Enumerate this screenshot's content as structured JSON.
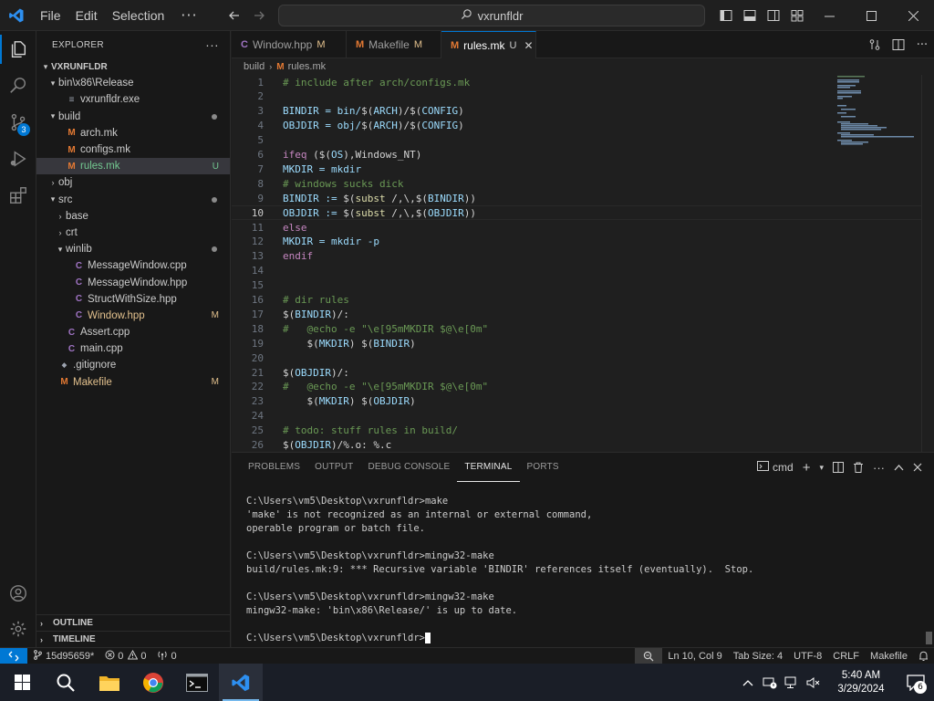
{
  "titlebar": {
    "menus": [
      "File",
      "Edit",
      "Selection"
    ],
    "search_text": "vxrunfldr"
  },
  "activity": {
    "source_control_badge": "3"
  },
  "sidebar": {
    "title": "EXPLORER",
    "root": "VXRUNFLDR",
    "items": [
      {
        "label": "bin\\x86\\Release",
        "depth": 1,
        "type": "folder-open",
        "icon": "folder",
        "deco": ""
      },
      {
        "label": "vxrunfldr.exe",
        "depth": 2,
        "type": "file",
        "icon": "exe",
        "deco": ""
      },
      {
        "label": "build",
        "depth": 1,
        "type": "folder-open",
        "icon": "folder",
        "deco": "dot"
      },
      {
        "label": "arch.mk",
        "depth": 2,
        "type": "file",
        "icon": "M",
        "deco": ""
      },
      {
        "label": "configs.mk",
        "depth": 2,
        "type": "file",
        "icon": "M",
        "deco": ""
      },
      {
        "label": "rules.mk",
        "depth": 2,
        "type": "file",
        "icon": "M",
        "deco": "U",
        "selected": true
      },
      {
        "label": "obj",
        "depth": 1,
        "type": "folder-closed",
        "icon": "folder",
        "deco": ""
      },
      {
        "label": "src",
        "depth": 1,
        "type": "folder-open",
        "icon": "folder",
        "deco": "dot"
      },
      {
        "label": "base",
        "depth": 2,
        "type": "folder-closed",
        "icon": "folder",
        "deco": ""
      },
      {
        "label": "crt",
        "depth": 2,
        "type": "folder-closed",
        "icon": "folder",
        "deco": ""
      },
      {
        "label": "winlib",
        "depth": 2,
        "type": "folder-open",
        "icon": "folder",
        "deco": "dot"
      },
      {
        "label": "MessageWindow.cpp",
        "depth": 3,
        "type": "file",
        "icon": "C",
        "deco": ""
      },
      {
        "label": "MessageWindow.hpp",
        "depth": 3,
        "type": "file",
        "icon": "C",
        "deco": ""
      },
      {
        "label": "StructWithSize.hpp",
        "depth": 3,
        "type": "file",
        "icon": "C",
        "deco": ""
      },
      {
        "label": "Window.hpp",
        "depth": 3,
        "type": "file",
        "icon": "C",
        "deco": "M"
      },
      {
        "label": "Assert.cpp",
        "depth": 2,
        "type": "file",
        "icon": "C",
        "deco": ""
      },
      {
        "label": "main.cpp",
        "depth": 2,
        "type": "file",
        "icon": "C",
        "deco": ""
      },
      {
        "label": ".gitignore",
        "depth": 1,
        "type": "file",
        "icon": "git",
        "deco": ""
      },
      {
        "label": "Makefile",
        "depth": 1,
        "type": "file",
        "icon": "M",
        "deco": "M"
      }
    ],
    "outline": "OUTLINE",
    "timeline": "TIMELINE"
  },
  "tabs": [
    {
      "label": "Window.hpp",
      "icon": "C",
      "deco": "M",
      "active": false
    },
    {
      "label": "Makefile",
      "icon": "M",
      "deco": "M",
      "active": false
    },
    {
      "label": "rules.mk",
      "icon": "M",
      "deco": "U",
      "active": true
    }
  ],
  "breadcrumb": [
    "build",
    "rules.mk"
  ],
  "editor": {
    "current_line": 10,
    "lines": [
      [
        {
          "t": "# include after arch/configs.mk",
          "c": "#6a9955"
        }
      ],
      [],
      [
        {
          "t": "BINDIR = bin/",
          "c": "#9cdcfe"
        },
        {
          "t": "$(",
          "c": "#d4d4d4"
        },
        {
          "t": "ARCH",
          "c": "#9cdcfe"
        },
        {
          "t": ")/",
          "c": "#d4d4d4"
        },
        {
          "t": "$(",
          "c": "#d4d4d4"
        },
        {
          "t": "CONFIG",
          "c": "#9cdcfe"
        },
        {
          "t": ")",
          "c": "#d4d4d4"
        }
      ],
      [
        {
          "t": "OBJDIR = obj/",
          "c": "#9cdcfe"
        },
        {
          "t": "$(",
          "c": "#d4d4d4"
        },
        {
          "t": "ARCH",
          "c": "#9cdcfe"
        },
        {
          "t": ")/",
          "c": "#d4d4d4"
        },
        {
          "t": "$(",
          "c": "#d4d4d4"
        },
        {
          "t": "CONFIG",
          "c": "#9cdcfe"
        },
        {
          "t": ")",
          "c": "#d4d4d4"
        }
      ],
      [],
      [
        {
          "t": "ifeq ",
          "c": "#c586c0"
        },
        {
          "t": "($(",
          "c": "#d4d4d4"
        },
        {
          "t": "OS",
          "c": "#9cdcfe"
        },
        {
          "t": "),Windows_NT)",
          "c": "#d4d4d4"
        }
      ],
      [
        {
          "t": "MKDIR = mkdir",
          "c": "#9cdcfe"
        }
      ],
      [
        {
          "t": "# windows sucks dick",
          "c": "#6a9955"
        }
      ],
      [
        {
          "t": "BINDIR := ",
          "c": "#9cdcfe"
        },
        {
          "t": "$(",
          "c": "#d4d4d4"
        },
        {
          "t": "subst",
          "c": "#dcdcaa"
        },
        {
          "t": " /,\\,",
          "c": "#d4d4d4"
        },
        {
          "t": "$(",
          "c": "#d4d4d4"
        },
        {
          "t": "BINDIR",
          "c": "#9cdcfe"
        },
        {
          "t": "))",
          "c": "#d4d4d4"
        }
      ],
      [
        {
          "t": "OBJDIR := ",
          "c": "#9cdcfe"
        },
        {
          "t": "$(",
          "c": "#d4d4d4"
        },
        {
          "t": "subst",
          "c": "#dcdcaa"
        },
        {
          "t": " /,\\,",
          "c": "#d4d4d4"
        },
        {
          "t": "$(",
          "c": "#d4d4d4"
        },
        {
          "t": "OBJDIR",
          "c": "#9cdcfe"
        },
        {
          "t": "))",
          "c": "#d4d4d4"
        }
      ],
      [
        {
          "t": "else",
          "c": "#c586c0"
        }
      ],
      [
        {
          "t": "MKDIR = mkdir -p",
          "c": "#9cdcfe"
        }
      ],
      [
        {
          "t": "endif",
          "c": "#c586c0"
        }
      ],
      [],
      [],
      [
        {
          "t": "# dir rules",
          "c": "#6a9955"
        }
      ],
      [
        {
          "t": "$(",
          "c": "#d4d4d4"
        },
        {
          "t": "BINDIR",
          "c": "#9cdcfe"
        },
        {
          "t": ")/:",
          "c": "#d4d4d4"
        }
      ],
      [
        {
          "t": "#   @echo -e \"\\e[95mMKDIR $@\\e[0m\"",
          "c": "#6a9955"
        }
      ],
      [
        {
          "t": "    $(",
          "c": "#d4d4d4"
        },
        {
          "t": "MKDIR",
          "c": "#9cdcfe"
        },
        {
          "t": ") ",
          "c": "#d4d4d4"
        },
        {
          "t": "$(",
          "c": "#d4d4d4"
        },
        {
          "t": "BINDIR",
          "c": "#9cdcfe"
        },
        {
          "t": ")",
          "c": "#d4d4d4"
        }
      ],
      [],
      [
        {
          "t": "$(",
          "c": "#d4d4d4"
        },
        {
          "t": "OBJDIR",
          "c": "#9cdcfe"
        },
        {
          "t": ")/:",
          "c": "#d4d4d4"
        }
      ],
      [
        {
          "t": "#   @echo -e \"\\e[95mMKDIR $@\\e[0m\"",
          "c": "#6a9955"
        }
      ],
      [
        {
          "t": "    $(",
          "c": "#d4d4d4"
        },
        {
          "t": "MKDIR",
          "c": "#9cdcfe"
        },
        {
          "t": ") ",
          "c": "#d4d4d4"
        },
        {
          "t": "$(",
          "c": "#d4d4d4"
        },
        {
          "t": "OBJDIR",
          "c": "#9cdcfe"
        },
        {
          "t": ")",
          "c": "#d4d4d4"
        }
      ],
      [],
      [
        {
          "t": "# todo: stuff rules in build/",
          "c": "#6a9955"
        }
      ],
      [
        {
          "t": "$(",
          "c": "#d4d4d4"
        },
        {
          "t": "OBJDIR",
          "c": "#9cdcfe"
        },
        {
          "t": ")/%.o: %.c",
          "c": "#d4d4d4"
        }
      ]
    ]
  },
  "panel": {
    "tabs": [
      "PROBLEMS",
      "OUTPUT",
      "DEBUG CONSOLE",
      "TERMINAL",
      "PORTS"
    ],
    "active_tab": "TERMINAL",
    "shell": "cmd",
    "terminal_lines": [
      "C:\\Users\\vm5\\Desktop\\vxrunfldr>make",
      "'make' is not recognized as an internal or external command,",
      "operable program or batch file.",
      "",
      "C:\\Users\\vm5\\Desktop\\vxrunfldr>mingw32-make",
      "build/rules.mk:9: *** Recursive variable 'BINDIR' references itself (eventually).  Stop.",
      "",
      "C:\\Users\\vm5\\Desktop\\vxrunfldr>mingw32-make",
      "mingw32-make: 'bin\\x86\\Release/' is up to date.",
      ""
    ],
    "prompt": "C:\\Users\\vm5\\Desktop\\vxrunfldr>"
  },
  "status": {
    "branch": "15d95659*",
    "errors": "0",
    "warnings": "0",
    "ports": "0",
    "position": "Ln 10, Col 9",
    "tab_size": "Tab Size: 4",
    "encoding": "UTF-8",
    "eol": "CRLF",
    "language": "Makefile"
  },
  "taskbar": {
    "time": "5:40 AM",
    "date": "3/29/2024",
    "notification_count": "6"
  },
  "colors": {
    "accent": "#0078d4",
    "makefile_icon": "#e37933",
    "cpp_icon": "#a074c4"
  }
}
